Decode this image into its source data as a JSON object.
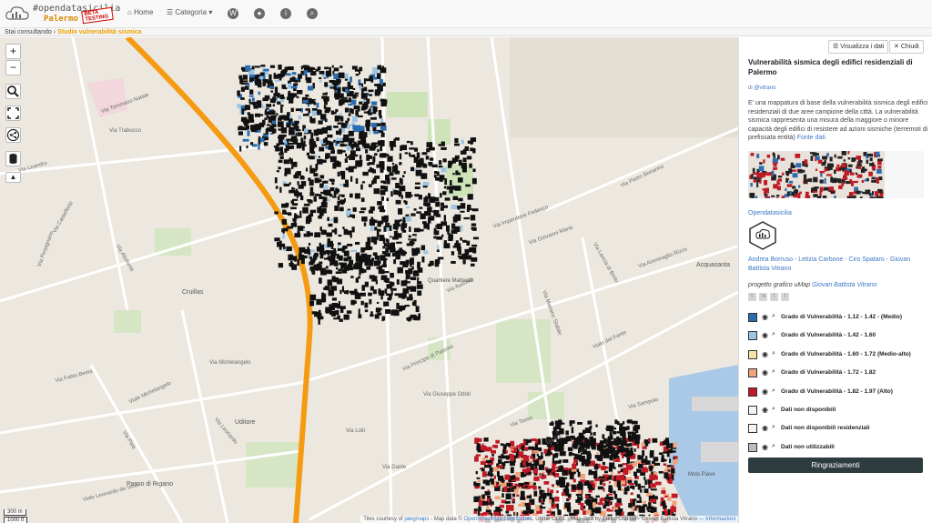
{
  "logo": {
    "tag": "#opendatasicilia",
    "city": "Palermo",
    "beta": "BETA TESTING"
  },
  "nav": {
    "home": "Home",
    "categoria": "Categoria",
    "circle_icons": [
      "W",
      "●",
      "i",
      "⌕"
    ]
  },
  "breadcrumb": {
    "prefix": "Stai consultando",
    "current": "Studio vulnerabilità sismica"
  },
  "map": {
    "streets": [
      "Via Tommaso Natale",
      "Via Trabucco",
      "Via Leandro",
      "Via Castelforte",
      "Via Altofonte",
      "Via Pietro Bonanno",
      "Via Imperatore Federico",
      "Via Giovanni Maria",
      "Via Ammiraglio Rizzo",
      "Via Principe di Paternò",
      "Via Ausonia",
      "Via Michelangelo",
      "Via Fabio Besta",
      "Viale Leonardo da Vinci",
      "Via Mariano Stabile",
      "Viale Michelangelo",
      "Via Giuseppe Oddo",
      "Via Lolli",
      "Via Dante",
      "Via Re",
      "Viale del Fante",
      "Via Sampolo",
      "Via Lancia di Brolo",
      "Via Perpignano",
      "Via Pitrè",
      "Via Tasso",
      "Via Leonardo"
    ],
    "place_labels": [
      "Cruillas",
      "Uditore",
      "Passo di Rigano",
      "Quartiere Matteotti",
      "Acquasanta",
      "Molo Piave"
    ],
    "scale": {
      "metric": "300 m",
      "imperial": "1000 ft"
    },
    "attribution": {
      "prefix": "Tiles courtesy of",
      "tiles": "jawgmaps",
      "data_prefix": "- Map data ©",
      "osm": "OpenStreetMap contributors",
      "rest": ", Under ODbL - Map data by Edifici Ospitali - Giovan Battista Vitrano",
      "info": "— Informazioni"
    }
  },
  "panel": {
    "view_data_button": "Visualizza i dati",
    "close_button": "Chiudi",
    "title": "Vulnerabilità sismica degli edifici residenziali di Palermo",
    "author_prefix": "di",
    "author": "@vitrano",
    "description": "E' una mappatura di base della vulnerabilità sismica degli edifici residenziali di due aree campione della città. La vulnerabilità sismica rappresenta una misura della maggiore o minore capacità degli edifici di resistere ad azioni sismiche (terremoti di prefissata entità)",
    "source_link": "Fonte dati",
    "org": "Opendatasicilia",
    "authors": "Andrea Borruso - Letizia Carbone - Ciro Spataro - Giovan Battista Vitrano",
    "graphic_prefix": "progetto grafico uMap",
    "graphic_author": "Giovan Battista Vitrano",
    "legend": [
      {
        "label": "Grado di Vulnerabilità - 1.12 - 1.42 - (Medio)",
        "color": "#2a6db0"
      },
      {
        "label": "Grado di Vulnerabilità - 1.42 - 1.60",
        "color": "#9dc4e2"
      },
      {
        "label": "Grado di Vulnerabilità - 1.60 - 1.72 (Medio-alto)",
        "color": "#f7e3a8"
      },
      {
        "label": "Grado di Vulnerabilità - 1.72 - 1.82",
        "color": "#f0a278"
      },
      {
        "label": "Grado di Vulnerabilità - 1.82 - 1.97 (Alto)",
        "color": "#c01a26"
      },
      {
        "label": "Dati non disponibili",
        "color": "#f4f4f4"
      },
      {
        "label": "Dati non disponibili residenziali",
        "color": "#f4f4f4"
      },
      {
        "label": "Dati non utilizzabili",
        "color": "#bdbdbd"
      }
    ],
    "thanks_button": "Ringraziamenti"
  }
}
